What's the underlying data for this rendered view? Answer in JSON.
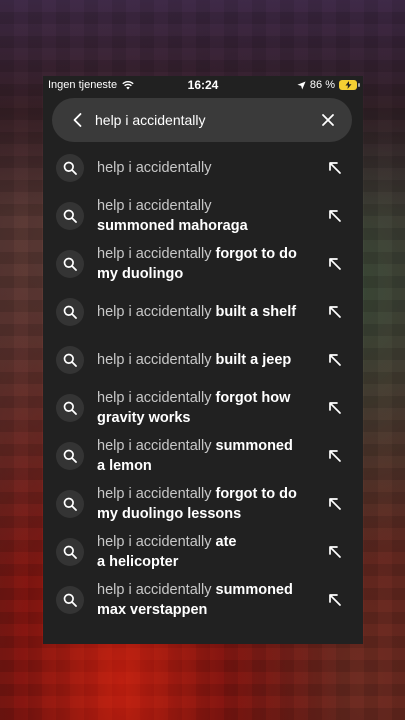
{
  "status_bar": {
    "carrier": "Ingen tjeneste",
    "time": "16:24",
    "battery": "86 %",
    "icons": [
      "wifi-icon",
      "location-arrow-icon",
      "battery-charging-icon"
    ]
  },
  "search": {
    "value": "help i accidentally",
    "back_icon": "chevron-left-icon",
    "clear_icon": "close-icon"
  },
  "suggestions": [
    {
      "lines": [
        {
          "normal": "help i accidentally",
          "bold": ""
        }
      ]
    },
    {
      "lines": [
        {
          "normal": "help i accidentally",
          "bold": ""
        },
        {
          "normal": "",
          "bold": "summoned mahoraga"
        }
      ]
    },
    {
      "lines": [
        {
          "normal": "help i accidentally ",
          "bold": "forgot to do"
        },
        {
          "normal": "",
          "bold": "my duolingo"
        }
      ]
    },
    {
      "lines": [
        {
          "normal": "help i accidentally ",
          "bold": "built a shelf"
        }
      ]
    },
    {
      "lines": [
        {
          "normal": "help i accidentally ",
          "bold": "built a jeep"
        }
      ]
    },
    {
      "lines": [
        {
          "normal": "help i accidentally ",
          "bold": "forgot how"
        },
        {
          "normal": "",
          "bold": "gravity works"
        }
      ]
    },
    {
      "lines": [
        {
          "normal": "help i accidentally ",
          "bold": "summoned"
        },
        {
          "normal": "",
          "bold": "a lemon"
        }
      ]
    },
    {
      "lines": [
        {
          "normal": "help i accidentally ",
          "bold": "forgot to do"
        },
        {
          "normal": "",
          "bold": "my duolingo lessons"
        }
      ]
    },
    {
      "lines": [
        {
          "normal": "help i accidentally ",
          "bold": "ate"
        },
        {
          "normal": "",
          "bold": "a helicopter"
        }
      ]
    },
    {
      "lines": [
        {
          "normal": "help i accidentally ",
          "bold": "summoned"
        },
        {
          "normal": "",
          "bold": "max verstappen"
        }
      ]
    }
  ],
  "colors": {
    "panel": "#212121",
    "search_bg": "#3a3a3a",
    "battery": "#f5d033"
  }
}
